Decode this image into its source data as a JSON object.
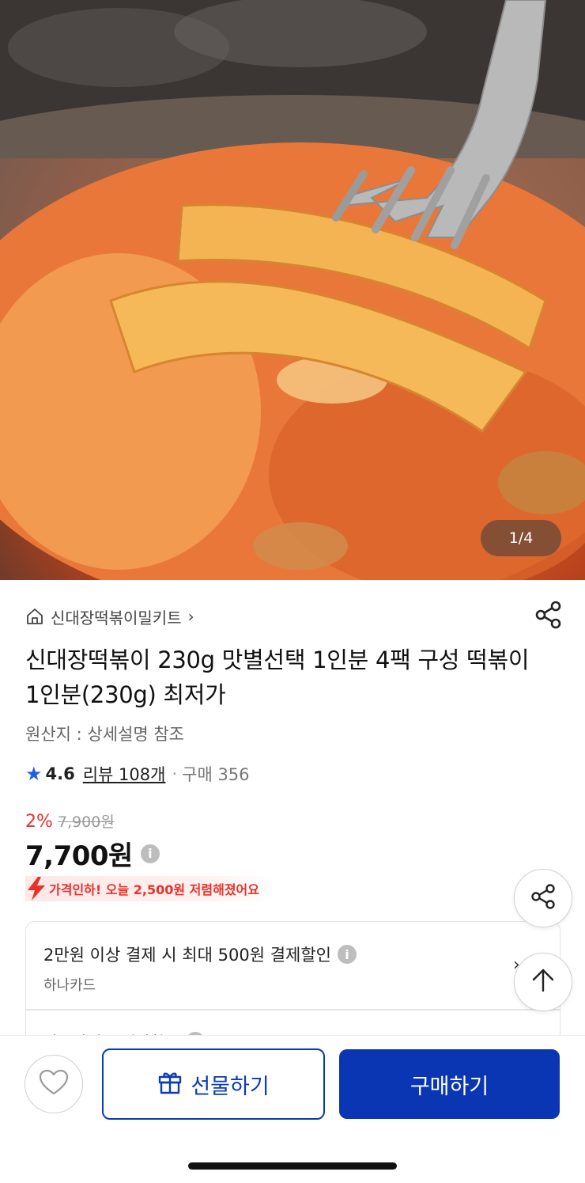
{
  "hero": {
    "counter": "1/4"
  },
  "store": {
    "name": "신대장떡볶이밀키트",
    "chevron": "›"
  },
  "product": {
    "title": "신대장떡볶이 230g 맛별선택 1인분 4팩 구성 떡볶이 1인분(230g) 최저가",
    "origin": "원산지 : 상세설명 참조"
  },
  "rating": {
    "star": "★",
    "score": "4.6",
    "review": "리뷰 108개",
    "dot": "·",
    "sales": "구매 356"
  },
  "price": {
    "discount": "2%",
    "original": "7,900원",
    "current": "7,700원",
    "info": "i",
    "drop_notice": "가격인하! 오늘 2,500원 저렴해졌어요"
  },
  "benefit": {
    "title": "2만원 이상 결제 시 최대 500원 결제할인",
    "card": "하나카드",
    "next_title": "카드사별 무이자할부",
    "chevron": "›"
  },
  "bottom": {
    "gift_label": "선물하기",
    "buy_label": "구매하기"
  },
  "colors": {
    "accent": "#0a36b4",
    "sale": "#e8312a",
    "star": "#1f5fe0"
  },
  "icons": [
    "home-icon",
    "share-icon",
    "star-icon",
    "info-icon",
    "lightning-icon",
    "arrow-up-icon",
    "heart-icon",
    "gift-icon"
  ]
}
